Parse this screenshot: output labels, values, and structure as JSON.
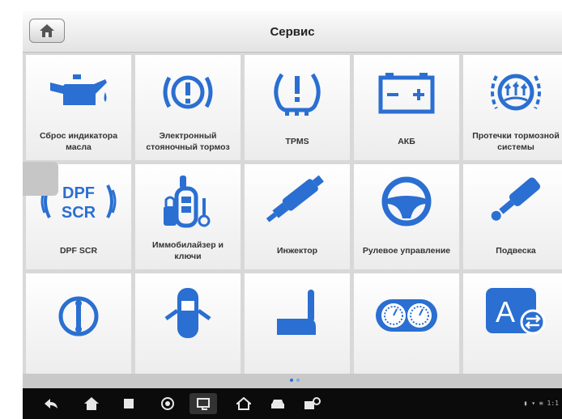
{
  "header": {
    "title": "Сервис"
  },
  "tiles": [
    {
      "label": "Сброс индикатора\nмасла",
      "icon": "oil-can-icon"
    },
    {
      "label": "Электронный\nстояночный тормоз",
      "icon": "parking-brake-icon"
    },
    {
      "label": "TPMS",
      "icon": "tire-pressure-icon"
    },
    {
      "label": "АКБ",
      "icon": "battery-icon"
    },
    {
      "label": "Протечки тормозной\nсистемы",
      "icon": "brake-fluid-icon"
    },
    {
      "label": "DPF SCR",
      "icon": "dpf-scr-icon",
      "icon_text_top": "DPF",
      "icon_text_bottom": "SCR"
    },
    {
      "label": "Иммобилайзер и\nключи",
      "icon": "immobilizer-key-icon"
    },
    {
      "label": "Инжектор",
      "icon": "injector-icon"
    },
    {
      "label": "Рулевое управление",
      "icon": "steering-wheel-icon"
    },
    {
      "label": "Подвеска",
      "icon": "suspension-icon"
    },
    {
      "label": "",
      "icon": "gearbox-icon"
    },
    {
      "label": "",
      "icon": "car-doors-icon"
    },
    {
      "label": "",
      "icon": "seat-icon"
    },
    {
      "label": "",
      "icon": "instrument-cluster-icon"
    },
    {
      "label": "",
      "icon": "language-switch-icon",
      "icon_text": "A"
    }
  ],
  "colors": {
    "accent": "#2a6fd1",
    "tile": "#f5f5f5",
    "navbar": "#0b0b0b"
  },
  "navbar": {
    "icons": [
      "back-icon",
      "home-icon",
      "recent-apps-icon",
      "autel-icon",
      "screenshot-icon",
      "vci-home-icon",
      "car-icon",
      "diagnostics-icon"
    ],
    "status": "▮ ▾ ≡ 1:1"
  }
}
